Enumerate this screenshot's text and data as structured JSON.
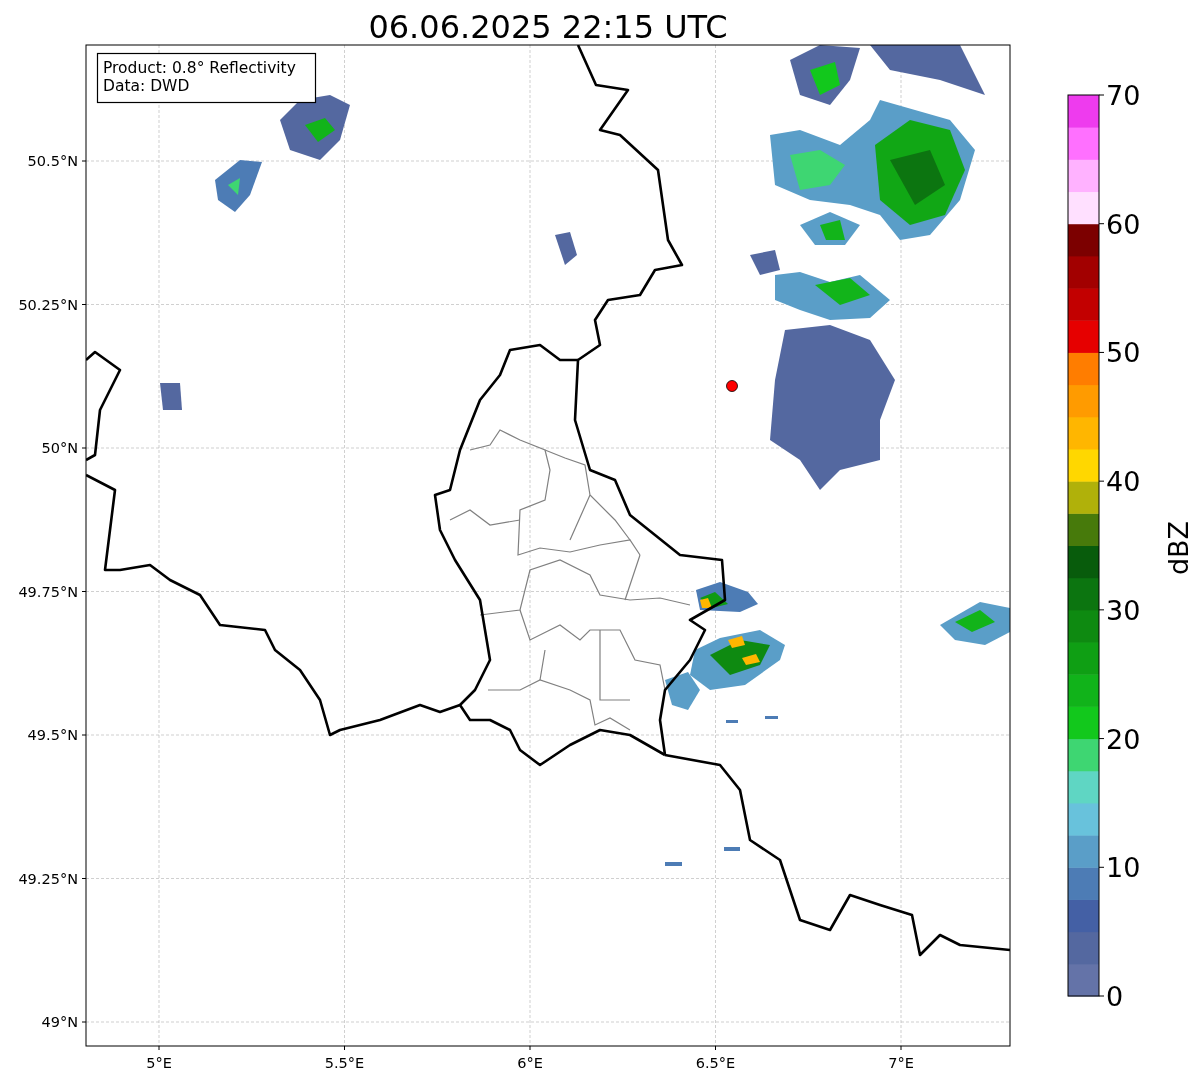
{
  "title": "06.06.2025 22:15 UTC",
  "annotation": [
    "Product: 0.8° Reflectivity",
    "Data: DWD"
  ],
  "x_ticks": [
    "5°E",
    "5.5°E",
    "6°E",
    "6.5°E",
    "7°E"
  ],
  "y_ticks": [
    "50.5°N",
    "50.25°N",
    "50°N",
    "49.75°N",
    "49.5°N",
    "49.25°N",
    "49°N"
  ],
  "colorbar": {
    "ticks": [
      "70",
      "60",
      "50",
      "40",
      "30",
      "20",
      "10",
      "0"
    ],
    "label": "dBZ"
  }
}
